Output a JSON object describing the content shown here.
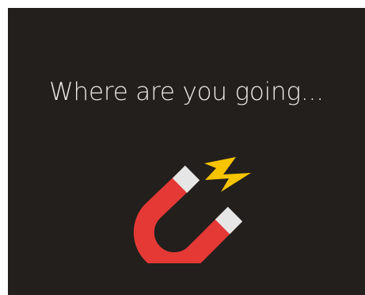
{
  "screen": {
    "message": "Where are you going...",
    "icon": "magnet-icon",
    "colors": {
      "background": "#221f1d",
      "frame": "#ffffff",
      "text": "#ece9e4",
      "magnet": "#e53935",
      "magnet_tip": "#e6e6e6",
      "spark": "#f6c400"
    }
  }
}
